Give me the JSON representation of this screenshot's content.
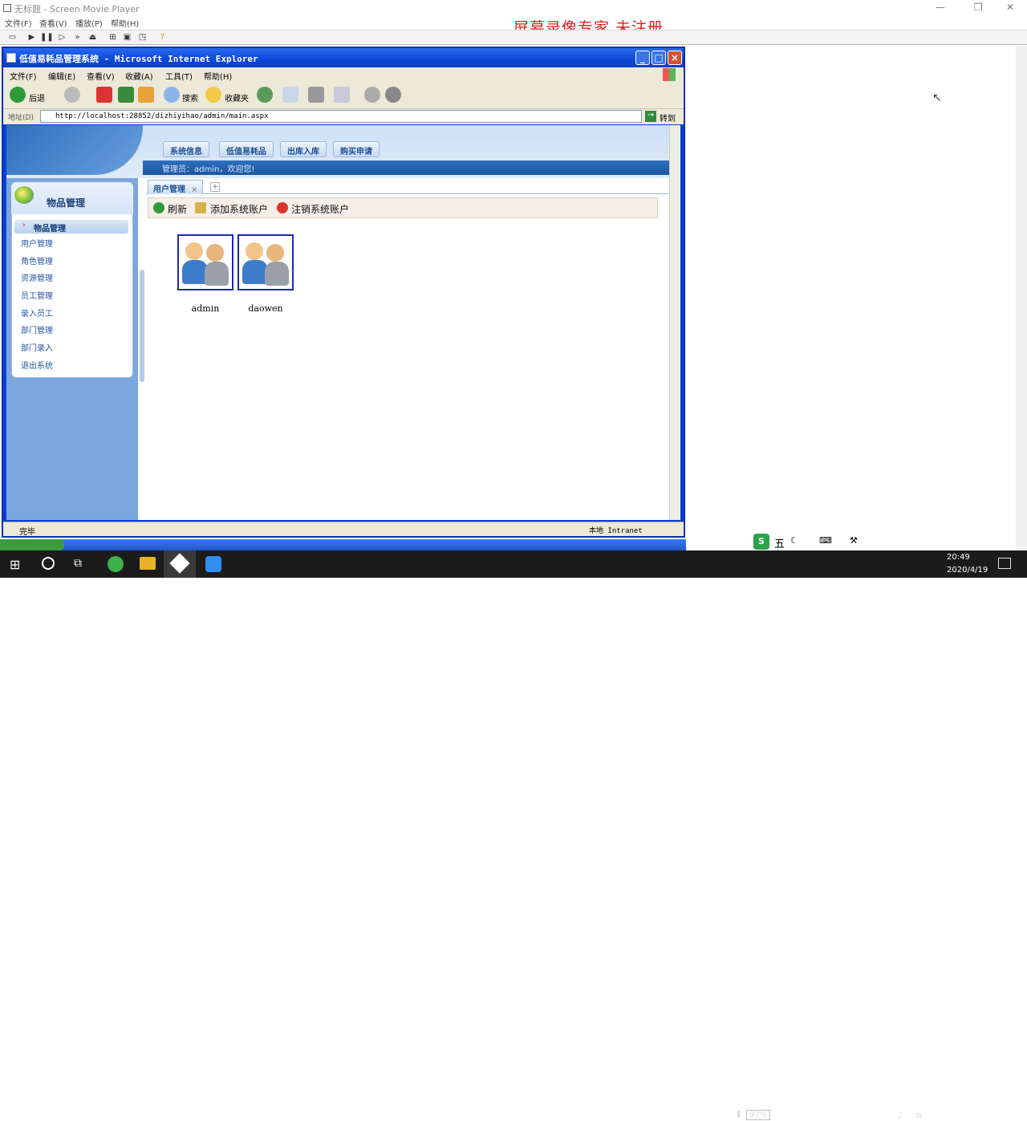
{
  "player": {
    "title": "无标题 - Screen Movie Player",
    "menu": [
      "文件(F)",
      "查看(V)",
      "播放(P)",
      "帮助(H)"
    ],
    "watermark": "屏幕录像专家  未注册"
  },
  "ie": {
    "title": "低值易耗品管理系统 - Microsoft Internet Explorer",
    "menu": [
      "文件(F)",
      "编辑(E)",
      "查看(V)",
      "收藏(A)",
      "工具(T)",
      "帮助(H)"
    ],
    "toolbar": {
      "back": "后退",
      "search": "搜索",
      "favorites": "收藏夹"
    },
    "address_label": "地址(D)",
    "address": "http://localhost:28852/dizhiyihao/admin/main.aspx",
    "go": "转到",
    "status_left": "完毕",
    "status_right": "本地 Intranet"
  },
  "page": {
    "nav": [
      "系统信息",
      "低值易耗品",
      "出库入库",
      "购买申请"
    ],
    "welcome": "管理员：admin，欢迎您!",
    "sidebar": {
      "title": "物品管理",
      "group": "物品管理",
      "items": [
        "用户管理",
        "角色管理",
        "资源管理",
        "员工管理",
        "录入员工",
        "部门管理",
        "部门录入",
        "退出系统"
      ]
    },
    "tab": "用户管理",
    "actions": {
      "refresh": "刷新",
      "add": "添加系统账户",
      "remove": "注销系统账户"
    },
    "users": [
      "admin",
      "daowen"
    ]
  },
  "ime": {
    "label": "五"
  },
  "clock": {
    "time": "20:49",
    "date": "2020/4/19",
    "battery": "97%"
  },
  "colors": {
    "ie_blue": "#0a3fd3",
    "watermark": "#e02020",
    "side_bg": "#7aa7dd",
    "user_border": "#1e2ab4"
  }
}
